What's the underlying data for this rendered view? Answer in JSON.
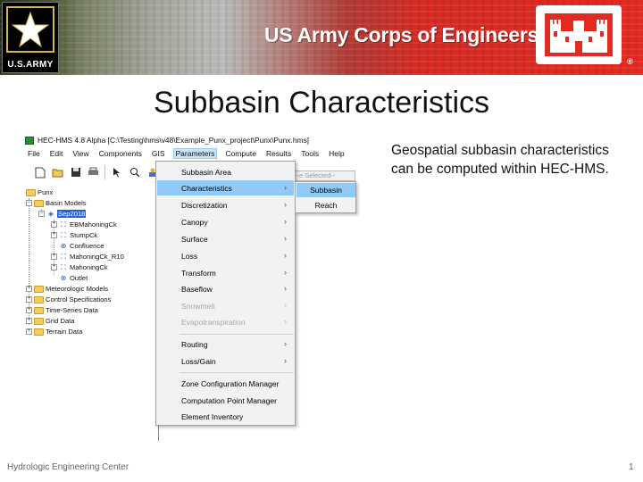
{
  "banner": {
    "army_text": "U.S.ARMY",
    "org_title": "US Army Corps of Engineers",
    "reg_mark": "®"
  },
  "slide": {
    "title": "Subbasin Characteristics",
    "description": "Geospatial subbasin characteristics can be computed within HEC-HMS."
  },
  "app": {
    "window_title": "HEC-HMS 4.8 Alpha [C:\\Testing\\hms\\v48\\Example_Punx_project\\Punx\\Punx.hms]",
    "menu": [
      "File",
      "Edit",
      "View",
      "Components",
      "GIS",
      "Parameters",
      "Compute",
      "Results",
      "Tools",
      "Help"
    ],
    "active_menu": "Parameters",
    "selected_combo": "--e Selected--",
    "tree": {
      "root": "Punx",
      "basin_models": "Basin Models",
      "basin": "Sep2018",
      "elements": [
        "EBMahoningCk",
        "StumpCk",
        "Confluence",
        "MahoningCk_R10",
        "MahoningCk",
        "Outlet"
      ],
      "folders": [
        "Meteorologic Models",
        "Control Specifications",
        "Time-Series Data",
        "Grid Data",
        "Terrain Data"
      ]
    },
    "parameters_menu": [
      {
        "label": "Subbasin Area",
        "arrow": ""
      },
      {
        "label": "Characteristics",
        "arrow": "›"
      },
      {
        "label": "Discretization",
        "arrow": "›"
      },
      {
        "label": "Canopy",
        "arrow": "›"
      },
      {
        "label": "Surface",
        "arrow": "›"
      },
      {
        "label": "Loss",
        "arrow": "›"
      },
      {
        "label": "Transform",
        "arrow": "›"
      },
      {
        "label": "Baseflow",
        "arrow": "›"
      },
      {
        "label": "Snowmelt",
        "arrow": "›"
      },
      {
        "label": "Evapotranspiration",
        "arrow": "›"
      },
      {
        "label": "Routing",
        "arrow": "›"
      },
      {
        "label": "Loss/Gain",
        "arrow": "›"
      },
      {
        "label": "Zone Configuration Manager",
        "arrow": ""
      },
      {
        "label": "Computation Point Manager",
        "arrow": ""
      },
      {
        "label": "Element Inventory",
        "arrow": ""
      }
    ],
    "characteristics_submenu": [
      "Subbasin",
      "Reach"
    ]
  },
  "footer": {
    "org": "Hydrologic Engineering Center",
    "page": "1"
  },
  "colors": {
    "menu_highlight": "#91c9f7",
    "banner_red": "#e12a22",
    "tree_selection": "#2a62d6"
  }
}
